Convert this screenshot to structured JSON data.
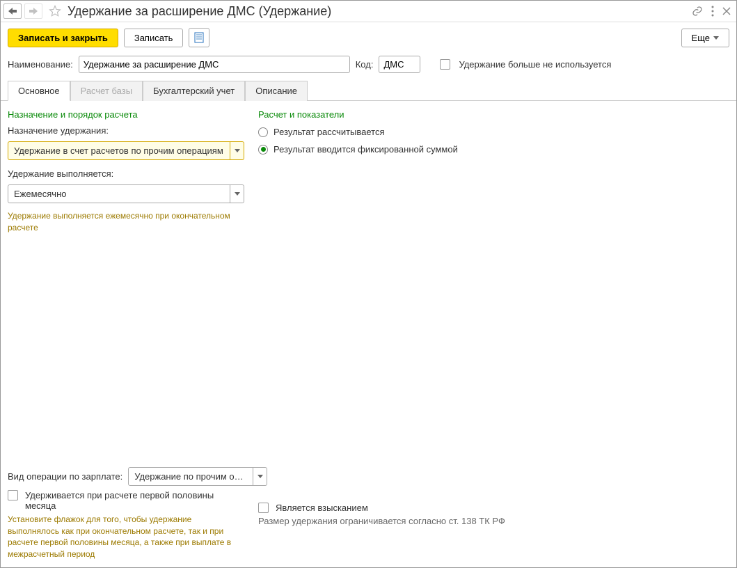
{
  "title": "Удержание за расширение ДМС (Удержание)",
  "toolbar": {
    "save_close": "Записать и закрыть",
    "save": "Записать",
    "more": "Еще"
  },
  "fields": {
    "name_label": "Наименование:",
    "name_value": "Удержание за расширение ДМС",
    "code_label": "Код:",
    "code_value": "ДМС",
    "not_used_label": "Удержание больше не используется"
  },
  "tabs": {
    "main": "Основное",
    "base": "Расчет базы",
    "accounting": "Бухгалтерский учет",
    "description": "Описание"
  },
  "left": {
    "section": "Назначение и порядок расчета",
    "purpose_label": "Назначение удержания:",
    "purpose_value": "Удержание в счет расчетов по прочим операциям",
    "exec_label": "Удержание выполняется:",
    "exec_value": "Ежемесячно",
    "hint": "Удержание выполняется ежемесячно при окончательном расчете"
  },
  "right": {
    "section": "Расчет и показатели",
    "radio1": "Результат рассчитывается",
    "radio2": "Результат вводится фиксированной суммой"
  },
  "bottom": {
    "op_label": "Вид операции по зарплате:",
    "op_value": "Удержание по прочим операциям",
    "first_half_label": "Удерживается при расчете первой половины месяца",
    "first_half_hint": "Установите флажок для того, чтобы удержание выполнялось как при окончательном расчете, так и при расчете первой половины месяца, а также при выплате в межрасчетный период",
    "penalty_label": "Является взысканием",
    "penalty_note": "Размер удержания ограничивается согласно ст. 138 ТК РФ"
  }
}
